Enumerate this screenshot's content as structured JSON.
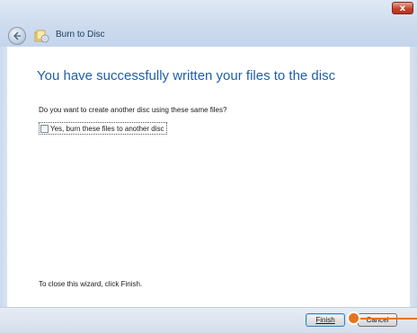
{
  "window": {
    "title": "Burn to Disc",
    "close_glyph": "x"
  },
  "content": {
    "heading": "You have successfully written your files to the disc",
    "question": "Do you want to create another disc using these same files?",
    "checkbox_label": "Yes, burn these files to another disc",
    "checkbox_checked": false,
    "footer_note": "To close this wizard, click Finish."
  },
  "buttons": {
    "finish_label": "Finish",
    "cancel_label": "Cancel"
  },
  "icons": {
    "back": "back-arrow-icon",
    "title": "burn-disc-icon",
    "close": "close-icon"
  },
  "colors": {
    "heading": "#1f5fa8",
    "frame": "#cddbee",
    "callout": "#e8731a",
    "close_button": "#c8442f"
  }
}
